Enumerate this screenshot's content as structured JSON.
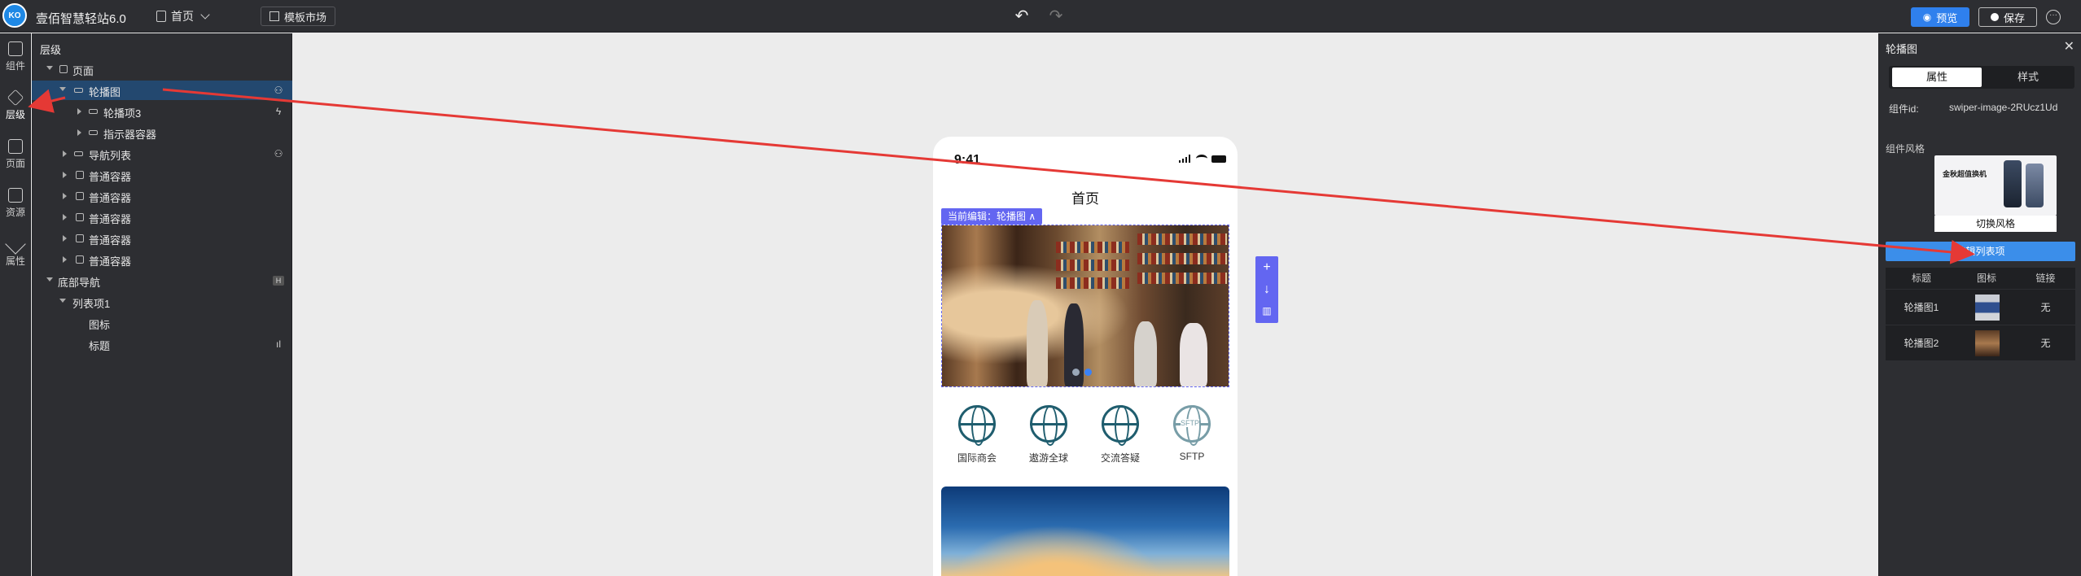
{
  "topbar": {
    "logo_text": "KO",
    "app_title": "壹佰智慧轻站6.0",
    "page_select_label": "首页",
    "template_market_label": "模板市场",
    "preview_label": "预览",
    "save_label": "保存"
  },
  "rail": {
    "items": [
      {
        "label": "组件",
        "icon": "grid-icon"
      },
      {
        "label": "层级",
        "icon": "layers-icon"
      },
      {
        "label": "页面",
        "icon": "pages-icon"
      },
      {
        "label": "资源",
        "icon": "image-icon"
      },
      {
        "label": "属性",
        "icon": "wand-icon"
      }
    ]
  },
  "layers": {
    "title": "层级",
    "rows": [
      {
        "label": "页面"
      },
      {
        "label": "轮播图"
      },
      {
        "label": "轮播项3"
      },
      {
        "label": "指示器容器"
      },
      {
        "label": "导航列表"
      },
      {
        "label": "普通容器"
      },
      {
        "label": "普通容器"
      },
      {
        "label": "普通容器"
      },
      {
        "label": "普通容器"
      },
      {
        "label": "普通容器"
      },
      {
        "label": "底部导航"
      },
      {
        "label": "列表项1"
      },
      {
        "label": "图标"
      },
      {
        "label": "标题"
      }
    ],
    "bottom_nav_badge": "H"
  },
  "phone": {
    "time": "9:41",
    "title": "首页",
    "edit_tag": "当前编辑：轮播图 ∧",
    "nav_items": [
      {
        "label": "国际商会"
      },
      {
        "label": "遨游全球"
      },
      {
        "label": "交流答疑"
      },
      {
        "label": "SFTP"
      }
    ],
    "sftp_icon_text": "SFTP"
  },
  "side_tools": {
    "add": "+",
    "down": "↓",
    "delete": "🗑"
  },
  "props": {
    "title": "轮播图",
    "tab_attr": "属性",
    "tab_style": "样式",
    "component_id_label": "组件id:",
    "component_id_value": "swiper-image-2RUcz1Ud",
    "style_label": "组件风格",
    "style_thumb_text": "金秋超值换机",
    "switch_style_label": "切换风格",
    "edit_list_label": "编辑列表项",
    "table": {
      "headers": [
        "标题",
        "图标",
        "链接"
      ],
      "rows": [
        {
          "title": "轮播图1",
          "link": "无"
        },
        {
          "title": "轮播图2",
          "link": "无"
        }
      ]
    }
  },
  "colors": {
    "accent": "#2f80ed",
    "selection": "#6366f1",
    "annotation_arrow": "#e53935"
  }
}
